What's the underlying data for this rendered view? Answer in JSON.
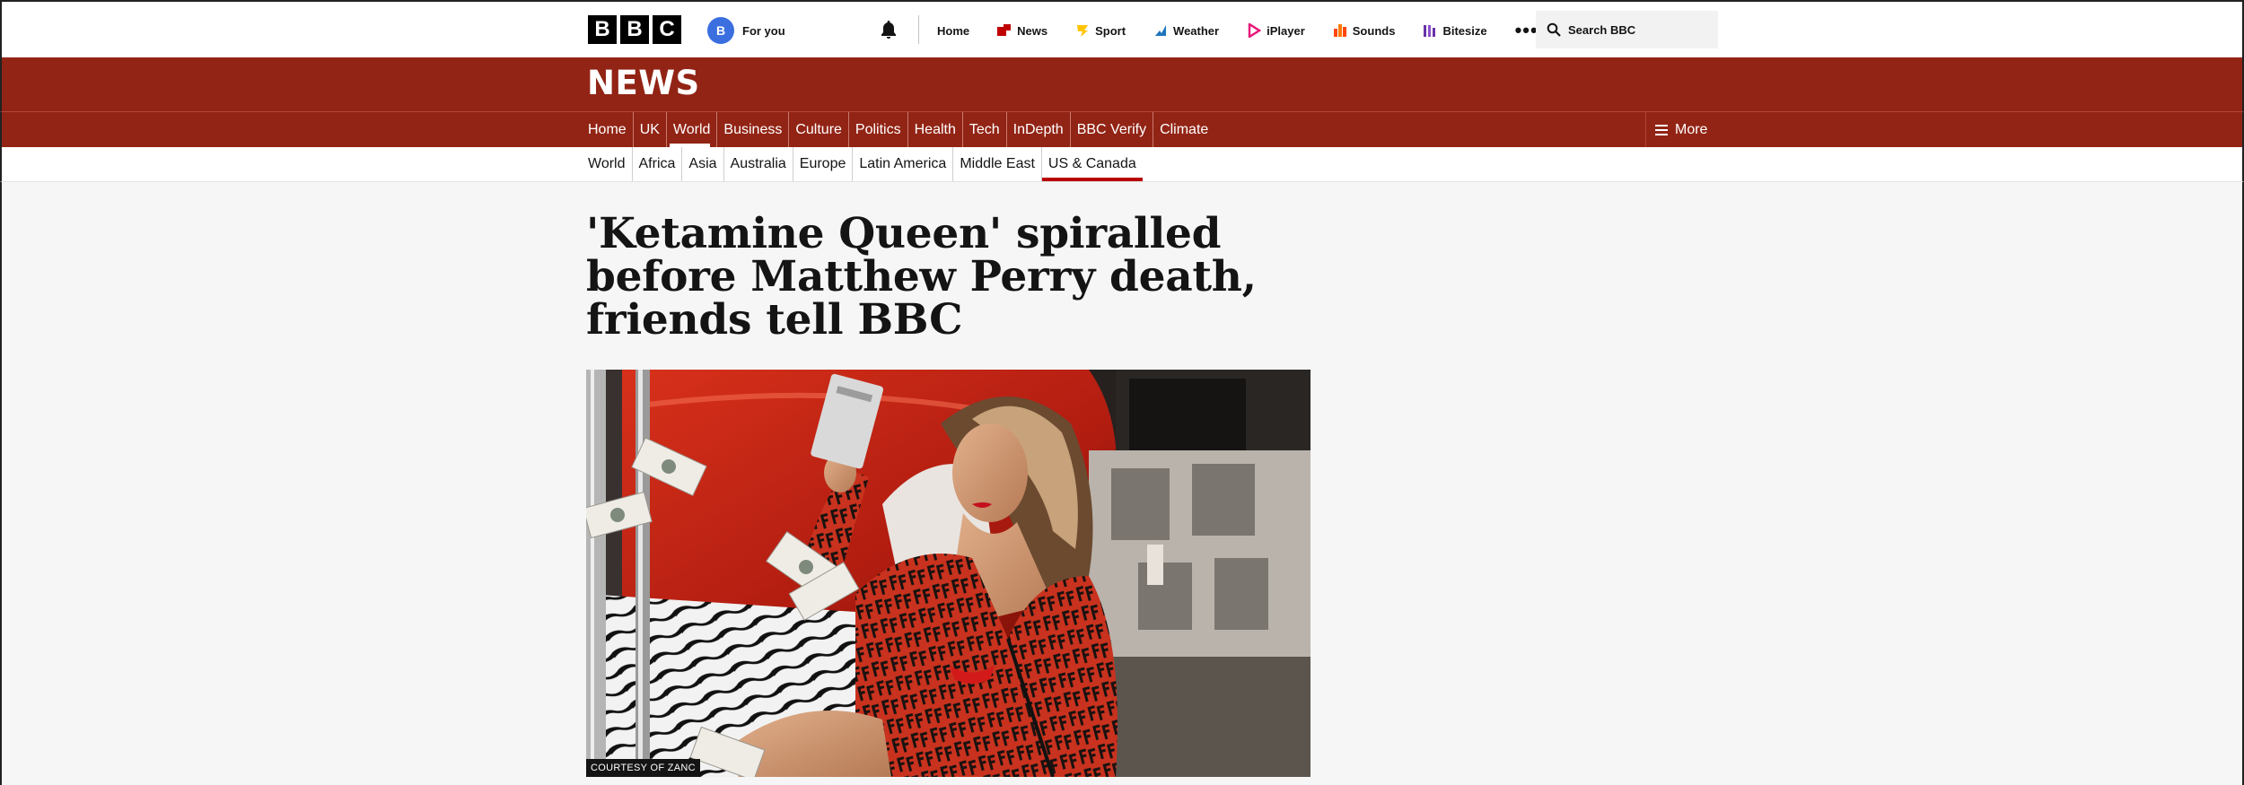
{
  "header": {
    "logo_letters": [
      "B",
      "B",
      "C"
    ],
    "avatar_letter": "B",
    "for_you_label": "For you",
    "nav": [
      {
        "label": "Home",
        "icon": "none"
      },
      {
        "label": "News",
        "icon": "news-icon",
        "color": "#c00000"
      },
      {
        "label": "Sport",
        "icon": "sport-icon",
        "color": "#ffd230"
      },
      {
        "label": "Weather",
        "icon": "weather-icon",
        "color": "#1e73be"
      },
      {
        "label": "iPlayer",
        "icon": "iplayer-icon",
        "color": "#f54997"
      },
      {
        "label": "Sounds",
        "icon": "sounds-icon",
        "color": "#ff4800"
      },
      {
        "label": "Bitesize",
        "icon": "bitesize-icon",
        "color": "#6932a8"
      }
    ],
    "more_dots": "•••",
    "search_label": "Search BBC"
  },
  "section": {
    "title": "NEWS",
    "brand_color": "#922415",
    "nav": [
      "Home",
      "UK",
      "World",
      "Business",
      "Culture",
      "Politics",
      "Health",
      "Tech",
      "InDepth",
      "BBC Verify",
      "Climate"
    ],
    "active_nav": "World",
    "more_label": "More",
    "subnav": [
      "World",
      "Africa",
      "Asia",
      "Australia",
      "Europe",
      "Latin America",
      "Middle East",
      "US & Canada"
    ],
    "active_subnav": "US & Canada"
  },
  "article": {
    "headline": "'Ketamine Queen' spiralled before Matthew Perry death, friends tell BBC",
    "image_caption": "COURTESY OF ZANC"
  }
}
